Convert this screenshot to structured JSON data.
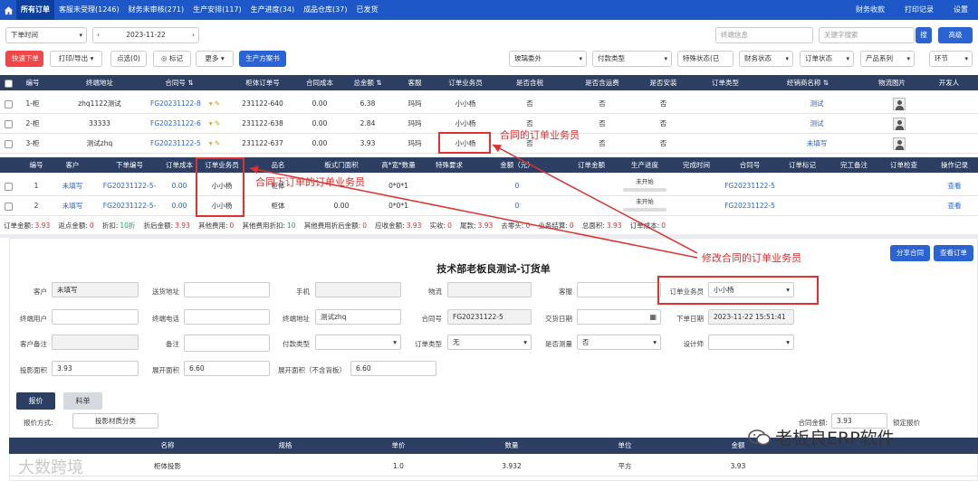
{
  "nav": {
    "tabs": [
      "所有订单",
      "客服未受理(1246)",
      "财务未审核(271)",
      "生产安排(117)",
      "生产进度(34)",
      "成品仓库(37)",
      "已发货"
    ],
    "right": [
      "财务收款",
      "打印记录",
      "设置"
    ]
  },
  "filters": {
    "time_type": "下单时间",
    "date": "2023-11-22",
    "order_info_ph": "终端信息",
    "keyword_ph": "关键字搜索",
    "search": "搜",
    "advanced": "高级"
  },
  "toolbar": {
    "quick": "快速下单",
    "print": "打印/导出",
    "select": "点选(0)",
    "mark": "标记",
    "more": "更多",
    "prod_plan": "生产方案书",
    "glass": "玻璃委外",
    "pay_type": "付款类型",
    "special": "特殊状态(已",
    "fin_status": "财务状态",
    "order_status": "订单状态",
    "product_series": "产品系列",
    "stage": "环节"
  },
  "main_table": {
    "headers": [
      "编号",
      "终端地址",
      "合同号",
      "柜体订单号",
      "合同成本",
      "总金额",
      "客服",
      "订单业务员",
      "是否含税",
      "是否含运费",
      "是否安装",
      "订单类型",
      "经销商名称",
      "物流图片",
      "开发人"
    ],
    "rows": [
      [
        "1-柜",
        "zhq1122测试",
        "FG20231122-8",
        "231122-640",
        "0.00",
        "6.38",
        "玛玛",
        "小小杨",
        "否",
        "否",
        "否",
        "",
        "测试"
      ],
      [
        "2-柜",
        "33333",
        "FG20231122-6",
        "231122-638",
        "0.00",
        "2.84",
        "玛玛",
        "小小杨",
        "否",
        "否",
        "否",
        "",
        "测试"
      ],
      [
        "3-柜",
        "测试zhq",
        "FG20231122-5",
        "231122-637",
        "0.00",
        "3.93",
        "玛玛",
        "小小杨",
        "否",
        "否",
        "否",
        "",
        "未填写"
      ]
    ]
  },
  "sub_table": {
    "headers": [
      "编号",
      "客户",
      "下单编号",
      "订单成本",
      "订单业务员",
      "品名",
      "板式门面积",
      "高*宽*数量",
      "特殊要求",
      "金额（元）",
      "订单金额",
      "生产进度",
      "完成时间",
      "合同号",
      "订单标记",
      "完工备注",
      "订单检查",
      "操作记录"
    ],
    "rows": [
      [
        "1",
        "未填写",
        "FG20231122-5-",
        "0.00",
        "小小杨",
        "柜体",
        "",
        "0*0*1",
        "",
        "0",
        "",
        "未开始",
        "",
        "FG20231122-5",
        "",
        "",
        "",
        "查看"
      ],
      [
        "2",
        "未填写",
        "FG20231122-5-",
        "0.00",
        "小小杨",
        "柜体",
        "0.00",
        "0*0*1",
        "",
        "0",
        "",
        "未开始",
        "",
        "FG20231122-5",
        "",
        "",
        "",
        "查看"
      ]
    ]
  },
  "summary": [
    [
      "订单金额:",
      "3.93"
    ],
    [
      "返点金额:",
      "0"
    ],
    [
      "折扣:",
      "10折"
    ],
    [
      "折后金额:",
      "3.93"
    ],
    [
      "其他费用:",
      "0"
    ],
    [
      "其他费用折扣:",
      "10"
    ],
    [
      "其他费用折后金额:",
      "0"
    ],
    [
      "应收金额:",
      "3.93"
    ],
    [
      "实收:",
      "0"
    ],
    [
      "尾款:",
      "3.93"
    ],
    [
      "去零头:",
      "0"
    ],
    [
      "业务结算:",
      "0"
    ],
    [
      "总面积:",
      "3.93"
    ],
    [
      "订单成本:",
      "0"
    ]
  ],
  "form": {
    "title": "技术部老板良测试-订货单",
    "share_btn": "分享合同",
    "view_btn": "查看订单",
    "customer_label": "客户",
    "customer": "未填写",
    "address_label": "送货地址",
    "phone_label": "手机",
    "logistics_label": "物流",
    "service_label": "客服",
    "salesman_label": "订单业务员",
    "salesman": "小小杨",
    "end_user_label": "终端用户",
    "end_phone_label": "终端电话",
    "end_addr_label": "终端地址",
    "end_addr": "测试zhq",
    "contract_label": "合同号",
    "contract": "FG20231122-5",
    "delivery_label": "交货日期",
    "order_date_label": "下单日期",
    "order_date": "2023-11-22 15:51:41",
    "cust_note_label": "客户备注",
    "note_label": "备注",
    "pay_type_label": "付款类型",
    "order_type_label": "订单类型",
    "order_type": "无",
    "measure_label": "是否测量",
    "measure": "否",
    "designer_label": "设计师",
    "proj_area_label": "投影面积",
    "proj_area": "3.93",
    "exp_area_label": "展开面积",
    "exp_area": "6.60",
    "exp_area2_label": "展开面积（不含背板）",
    "exp_area2": "6.60",
    "tab_quote": "报价",
    "tab_material": "料单",
    "quote_mode_label": "报价方式:",
    "quote_mode": "投影材质分类",
    "contract_amount_label": "合同金额:",
    "contract_amount": "3.93",
    "lock_quote": "锁定报价",
    "quote_headers": [
      "名称",
      "规格",
      "单价",
      "数量",
      "单位",
      "金额"
    ],
    "quote_row": [
      "柜体投影",
      "",
      "1.0",
      "3.932",
      "平方",
      "3.93"
    ]
  },
  "annotations": {
    "a1": "合同的订单业务员",
    "a2": "合同下订单的订单业务员",
    "a3": "修改合同的订单业务员"
  },
  "watermarks": {
    "left": "大数跨境",
    "right": "老板良ERP软件"
  },
  "colors": {
    "nav": "#1e58c8",
    "table_head": "#2c3f63",
    "accent": "#2a63d4",
    "danger": "#e03030"
  }
}
